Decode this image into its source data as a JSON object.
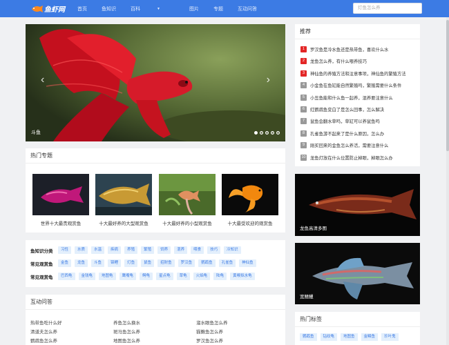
{
  "header": {
    "logo_text": "鱼虾网",
    "nav": [
      {
        "label": "首页"
      },
      {
        "label": "鱼知识"
      },
      {
        "label": "百科",
        "has_dropdown": true
      },
      {
        "label": "图片"
      },
      {
        "label": "专题"
      },
      {
        "label": "互动问答"
      }
    ],
    "search_placeholder": "灯鱼怎么养"
  },
  "hero": {
    "caption": "斗鱼",
    "slide_count": 5,
    "active_slide": 1
  },
  "topics": {
    "title": "热门专题",
    "items": [
      {
        "label": "世界十大最贵观赏鱼"
      },
      {
        "label": "十大最好养的大型观赏鱼"
      },
      {
        "label": "十大最好养的小型观赏鱼"
      },
      {
        "label": "十大最受欢迎的观赏鱼"
      }
    ]
  },
  "categories": [
    {
      "label": "鱼知识分类",
      "tags": [
        "习性",
        "水质",
        "水温",
        "疾病",
        "养殖",
        "繁殖",
        "饲养",
        "混养",
        "喂食",
        "技巧",
        "冷知识"
      ]
    },
    {
      "label": "常见观赏鱼",
      "tags": [
        "金鱼",
        "龙鱼",
        "斗鱼",
        "锦鲤",
        "灯鱼",
        "鼠鱼",
        "招财鱼",
        "罗汉鱼",
        "鹦鹉鱼",
        "孔雀鱼",
        "神仙鱼"
      ]
    },
    {
      "label": "常见观赏龟",
      "tags": [
        "巴西龟",
        "金钱龟",
        "地图龟",
        "鹰嘴龟",
        "鳄龟",
        "星点龟",
        "草龟",
        "火焰龟",
        "陆龟",
        "黄喉拟水龟"
      ]
    }
  ],
  "qa": {
    "title": "互动问答",
    "items": [
      "热带鱼吃什么好",
      "养鱼怎么换水",
      "溜水眼鱼怎么养",
      "清道夫怎么养",
      "斑马鱼怎么养",
      "猫鳅鱼怎么养",
      "鹦鹉鱼怎么养",
      "地图鱼怎么养",
      "罗汉鱼怎么养"
    ]
  },
  "recommend": {
    "title": "推荐",
    "items": [
      {
        "rank": "1",
        "text": "罗汉鱼是冷水鱼还是热带鱼，喜欢什么水",
        "color": "#e32626"
      },
      {
        "rank": "2",
        "text": "龙鱼怎么养，有什么喂养技巧",
        "color": "#e32626"
      },
      {
        "rank": "3",
        "text": "神仙鱼的养殖方法和注意事项，神仙鱼的繁殖方法",
        "color": "#e32626"
      },
      {
        "rank": "4",
        "text": "小金鱼在鱼缸能自然繁殖吗，繁殖需要什么条件",
        "color": "#999999"
      },
      {
        "rank": "5",
        "text": "小丑鱼能和什么鱼一起养，混养要注意什么",
        "color": "#999999"
      },
      {
        "rank": "6",
        "text": "红鹦鹉鱼变白了是怎么回事，怎么解决",
        "color": "#999999"
      },
      {
        "rank": "7",
        "text": "鼠鱼会翻水草吗，草缸可以养鼠鱼吗",
        "color": "#999999"
      },
      {
        "rank": "8",
        "text": "孔雀鱼游不起来了是什么原因，怎么办",
        "color": "#999999"
      },
      {
        "rank": "9",
        "text": "刚买回来的金鱼怎么养活，需要注意什么",
        "color": "#999999"
      },
      {
        "rank": "10",
        "text": "龙鱼灯放在什么位置防止掉眼，掉眼怎么办",
        "color": "#999999"
      }
    ]
  },
  "side_images": [
    {
      "caption": "龙鱼高清多图"
    },
    {
      "caption": "宽鳍鱲"
    }
  ],
  "hot_tags": {
    "title": "热门标签",
    "tags": [
      "鹦鹉鱼",
      "钻纹龟",
      "地图鱼",
      "金鳞鱼",
      "珍叶鬼"
    ]
  },
  "colors": {
    "brand": "#3c7be4",
    "tag_bg": "#e3effc"
  }
}
